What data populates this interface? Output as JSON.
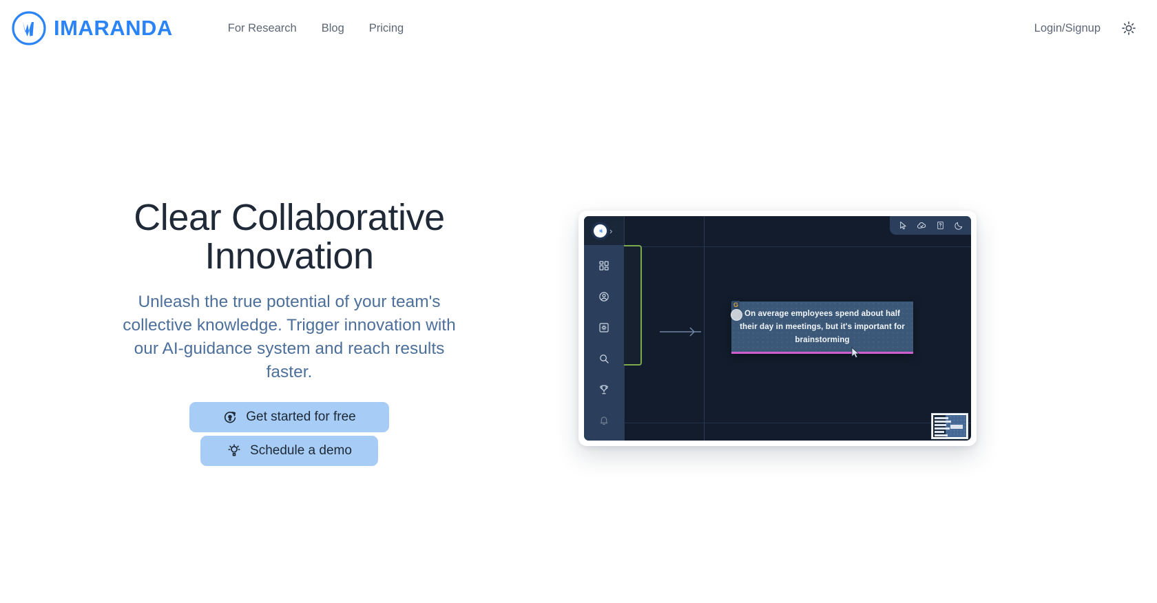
{
  "header": {
    "brand_name": "IMARANDA",
    "brand_icon": "imaranda-logo-icon",
    "nav": [
      {
        "label": "For Research"
      },
      {
        "label": "Blog"
      },
      {
        "label": "Pricing"
      }
    ],
    "login_label": "Login/Signup",
    "theme_toggle_icon": "sun-icon"
  },
  "hero": {
    "title": "Clear Collaborative Innovation",
    "subtitle": "Unleash the true potential of your team's collective knowledge. Trigger innovation with our AI-guidance system and reach results faster.",
    "primary_cta": {
      "label": "Get started for free",
      "icon": "rotate-bulb-icon"
    },
    "secondary_cta": {
      "label": "Schedule a demo",
      "icon": "idea-bulb-icon"
    }
  },
  "app_preview": {
    "logo_icon": "imaranda-logo-icon",
    "expand_icon": "chevron-right-icon",
    "sidebar_items": [
      {
        "icon": "dashboard-grid-icon"
      },
      {
        "icon": "user-profile-icon"
      },
      {
        "icon": "settings-box-icon"
      },
      {
        "icon": "search-icon"
      },
      {
        "icon": "trophy-icon"
      },
      {
        "icon": "bell-icon"
      },
      {
        "icon": "help-circle-icon"
      }
    ],
    "toolbar_items": [
      {
        "icon": "cursor-pointer-icon"
      },
      {
        "icon": "cloud-check-icon"
      },
      {
        "icon": "help-doc-icon"
      },
      {
        "icon": "moon-icon"
      }
    ],
    "card": {
      "badge": "G",
      "text": "On average employees spend about half their day in meetings, but it's important for brainstorming",
      "accent_color": "#cf5fd1"
    },
    "minimap_label": "minimap"
  },
  "colors": {
    "brand_blue": "#2b84f7",
    "cta_blue": "#a7cdf7",
    "heading": "#1f2937",
    "subtitle": "#4c6f9b",
    "nav_text": "#5d6674",
    "app_bg": "#121c2c",
    "app_sidebar": "#2b3f5c"
  }
}
